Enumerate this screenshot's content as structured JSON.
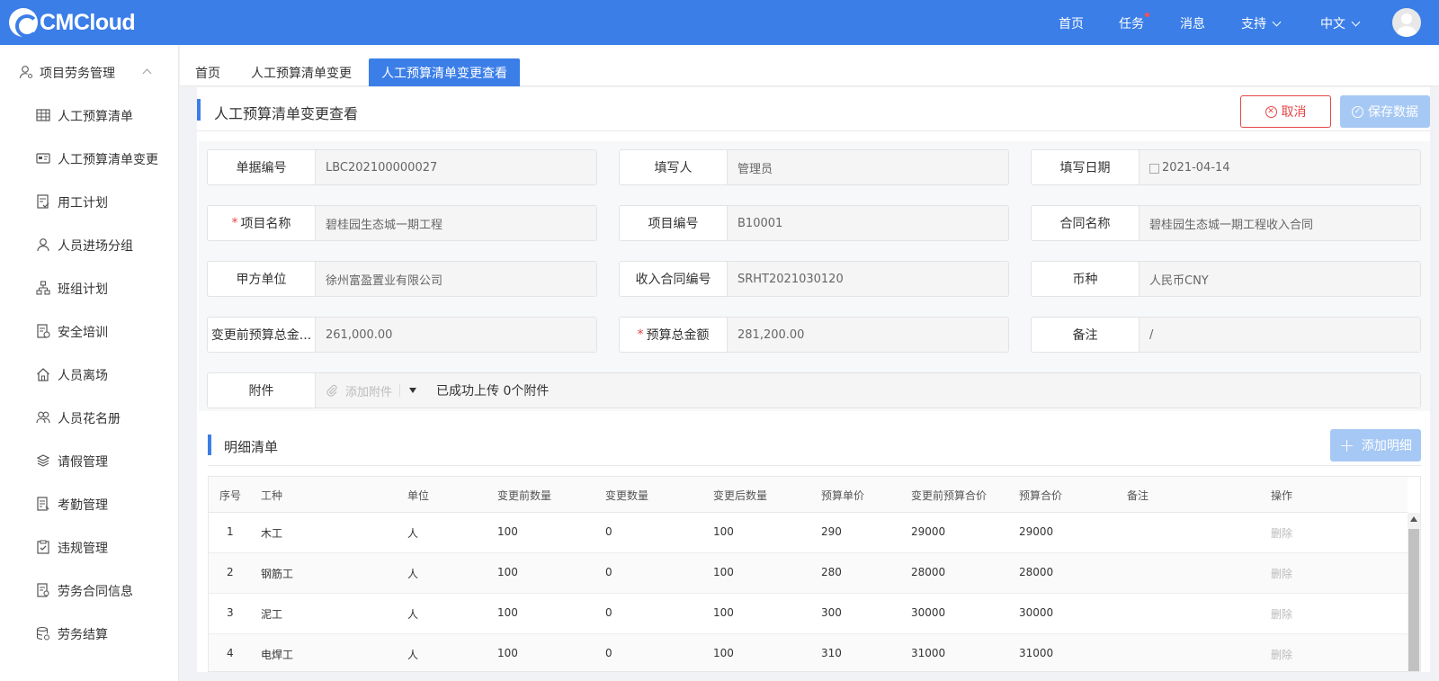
{
  "app": {
    "logo_text": "CMCloud",
    "brand_color": "#3b7ee8"
  },
  "topnav": {
    "home": "首页",
    "tasks": "任务",
    "messages": "消息",
    "support": "支持",
    "language": "中文"
  },
  "sidebar": {
    "group_label": "项目劳务管理",
    "items": [
      {
        "label": "人工预算清单",
        "icon": "grid-icon"
      },
      {
        "label": "人工预算清单变更",
        "icon": "card-icon"
      },
      {
        "label": "用工计划",
        "icon": "doc-check-icon"
      },
      {
        "label": "人员进场分组",
        "icon": "user-icon"
      },
      {
        "label": "班组计划",
        "icon": "org-icon"
      },
      {
        "label": "安全培训",
        "icon": "doc-edit-icon"
      },
      {
        "label": "人员离场",
        "icon": "home-icon"
      },
      {
        "label": "人员花名册",
        "icon": "users-icon"
      },
      {
        "label": "请假管理",
        "icon": "layers-icon"
      },
      {
        "label": "考勤管理",
        "icon": "doc-list-icon"
      },
      {
        "label": "违规管理",
        "icon": "clipboard-check-icon"
      },
      {
        "label": "劳务合同信息",
        "icon": "contract-icon"
      },
      {
        "label": "劳务结算",
        "icon": "database-icon"
      }
    ]
  },
  "tabs": [
    "首页",
    "人工预算清单变更",
    "人工预算清单变更查看"
  ],
  "page": {
    "title": "人工预算清单变更查看",
    "cancel_label": "取消",
    "save_label": "保存数据"
  },
  "form": {
    "doc_no": {
      "label": "单据编号",
      "value": "LBC202100000027"
    },
    "writer": {
      "label": "填写人",
      "value": "管理员"
    },
    "date": {
      "label": "填写日期",
      "value": "2021-04-14"
    },
    "project_name": {
      "label": "项目名称",
      "value": "碧桂园生态城一期工程",
      "required": true
    },
    "project_no": {
      "label": "项目编号",
      "value": "B10001"
    },
    "contract_name": {
      "label": "合同名称",
      "value": "碧桂园生态城一期工程收入合同"
    },
    "party_a": {
      "label": "甲方单位",
      "value": "徐州富盈置业有限公司"
    },
    "income_contract_no": {
      "label": "收入合同编号",
      "value": "SRHT2021030120"
    },
    "currency": {
      "label": "币种",
      "value": "人民币CNY"
    },
    "prev_total": {
      "label": "变更前预算总金...",
      "value": "261,000.00"
    },
    "budget_total": {
      "label": "预算总金额",
      "value": "281,200.00",
      "required": true
    },
    "remark": {
      "label": "备注",
      "value": "/"
    },
    "attachment": {
      "label": "附件",
      "add_label": "添加附件",
      "status": "已成功上传 0个附件"
    }
  },
  "details": {
    "title": "明细清单",
    "add_label": "添加明细",
    "columns": [
      "序号",
      "工种",
      "单位",
      "变更前数量",
      "变更数量",
      "变更后数量",
      "预算单价",
      "变更前预算合价",
      "预算合价",
      "备注",
      "操作"
    ],
    "rows": [
      {
        "no": "1",
        "type": "木工",
        "unit": "人",
        "prev_qty": "100",
        "change_qty": "0",
        "after_qty": "100",
        "price": "290",
        "prev_total": "29000",
        "total": "29000",
        "remark": "",
        "action": "删除"
      },
      {
        "no": "2",
        "type": "钢筋工",
        "unit": "人",
        "prev_qty": "100",
        "change_qty": "0",
        "after_qty": "100",
        "price": "280",
        "prev_total": "28000",
        "total": "28000",
        "remark": "",
        "action": "删除"
      },
      {
        "no": "3",
        "type": "泥工",
        "unit": "人",
        "prev_qty": "100",
        "change_qty": "0",
        "after_qty": "100",
        "price": "300",
        "prev_total": "30000",
        "total": "30000",
        "remark": "",
        "action": "删除"
      },
      {
        "no": "4",
        "type": "电焊工",
        "unit": "人",
        "prev_qty": "100",
        "change_qty": "0",
        "after_qty": "100",
        "price": "310",
        "prev_total": "31000",
        "total": "31000",
        "remark": "",
        "action": "删除"
      }
    ]
  }
}
